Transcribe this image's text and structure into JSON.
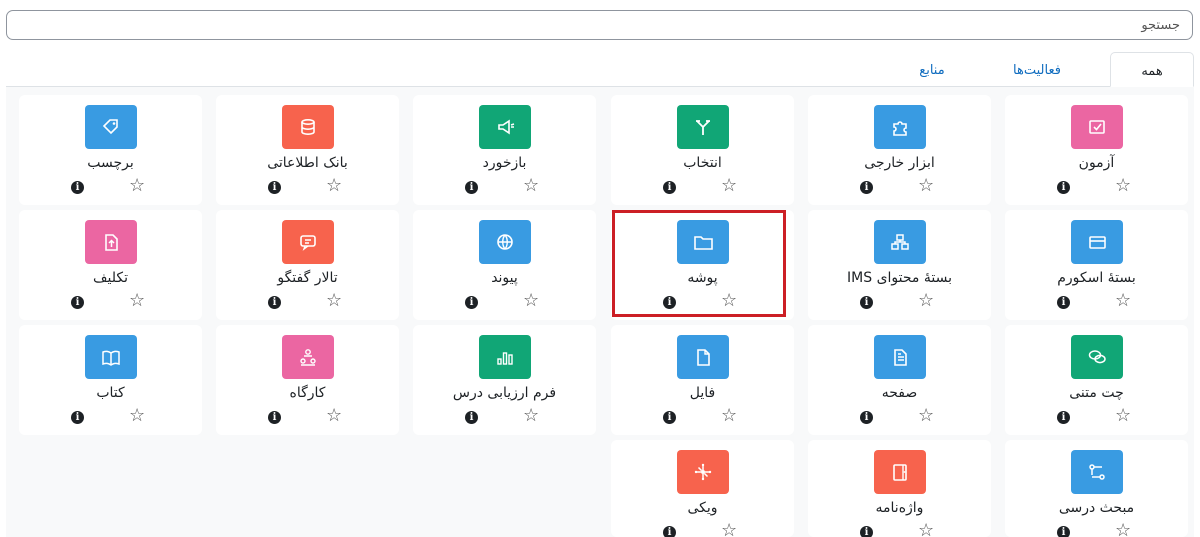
{
  "search": {
    "placeholder": "جستجو",
    "value": ""
  },
  "tabs": [
    {
      "label": "همه",
      "active": true
    },
    {
      "label": "فعالیت‌ها",
      "active": false
    },
    {
      "label": "منابع",
      "active": false
    }
  ],
  "colors": {
    "assessment": "#eb66a2",
    "content": "#399be2",
    "communication": "#f7634d",
    "collaboration": "#11a676",
    "highlight": "#cc1f25"
  },
  "modules": [
    {
      "label": "آزمون",
      "icon": "quiz-icon",
      "color": "assessment"
    },
    {
      "label": "ابزار خارجی",
      "icon": "puzzle-icon",
      "color": "content"
    },
    {
      "label": "انتخاب",
      "icon": "choice-icon",
      "color": "collaboration"
    },
    {
      "label": "بازخورد",
      "icon": "megaphone-icon",
      "color": "collaboration"
    },
    {
      "label": "بانک اطلاعاتی",
      "icon": "database-icon",
      "color": "communication"
    },
    {
      "label": "برچسب",
      "icon": "tag-icon",
      "color": "content"
    },
    {
      "label": "بستهٔ اسکورم",
      "icon": "scorm-package-icon",
      "color": "content"
    },
    {
      "label": "بستهٔ محتوای IMS",
      "icon": "ims-package-icon",
      "color": "content"
    },
    {
      "label": "پوشه",
      "icon": "folder-icon",
      "color": "content",
      "highlighted": true
    },
    {
      "label": "پیوند",
      "icon": "globe-icon",
      "color": "content"
    },
    {
      "label": "تالار گفتگو",
      "icon": "forum-icon",
      "color": "communication"
    },
    {
      "label": "تکلیف",
      "icon": "assignment-icon",
      "color": "assessment"
    },
    {
      "label": "چت متنی",
      "icon": "chat-icon",
      "color": "collaboration"
    },
    {
      "label": "صفحه",
      "icon": "page-icon",
      "color": "content"
    },
    {
      "label": "فایل",
      "icon": "file-icon",
      "color": "content"
    },
    {
      "label": "فرم ارزیابی درس",
      "icon": "bar-chart-icon",
      "color": "collaboration"
    },
    {
      "label": "کارگاه",
      "icon": "workshop-icon",
      "color": "assessment"
    },
    {
      "label": "کتاب",
      "icon": "book-icon",
      "color": "content"
    },
    {
      "label": "مبحث درسی",
      "icon": "subsection-icon",
      "color": "content"
    },
    {
      "label": "واژه‌نامه",
      "icon": "glossary-icon",
      "color": "communication"
    },
    {
      "label": "ویکی",
      "icon": "wiki-icon",
      "color": "communication"
    }
  ],
  "card_actions": {
    "info_glyph": "i",
    "star_glyph": "☆"
  }
}
